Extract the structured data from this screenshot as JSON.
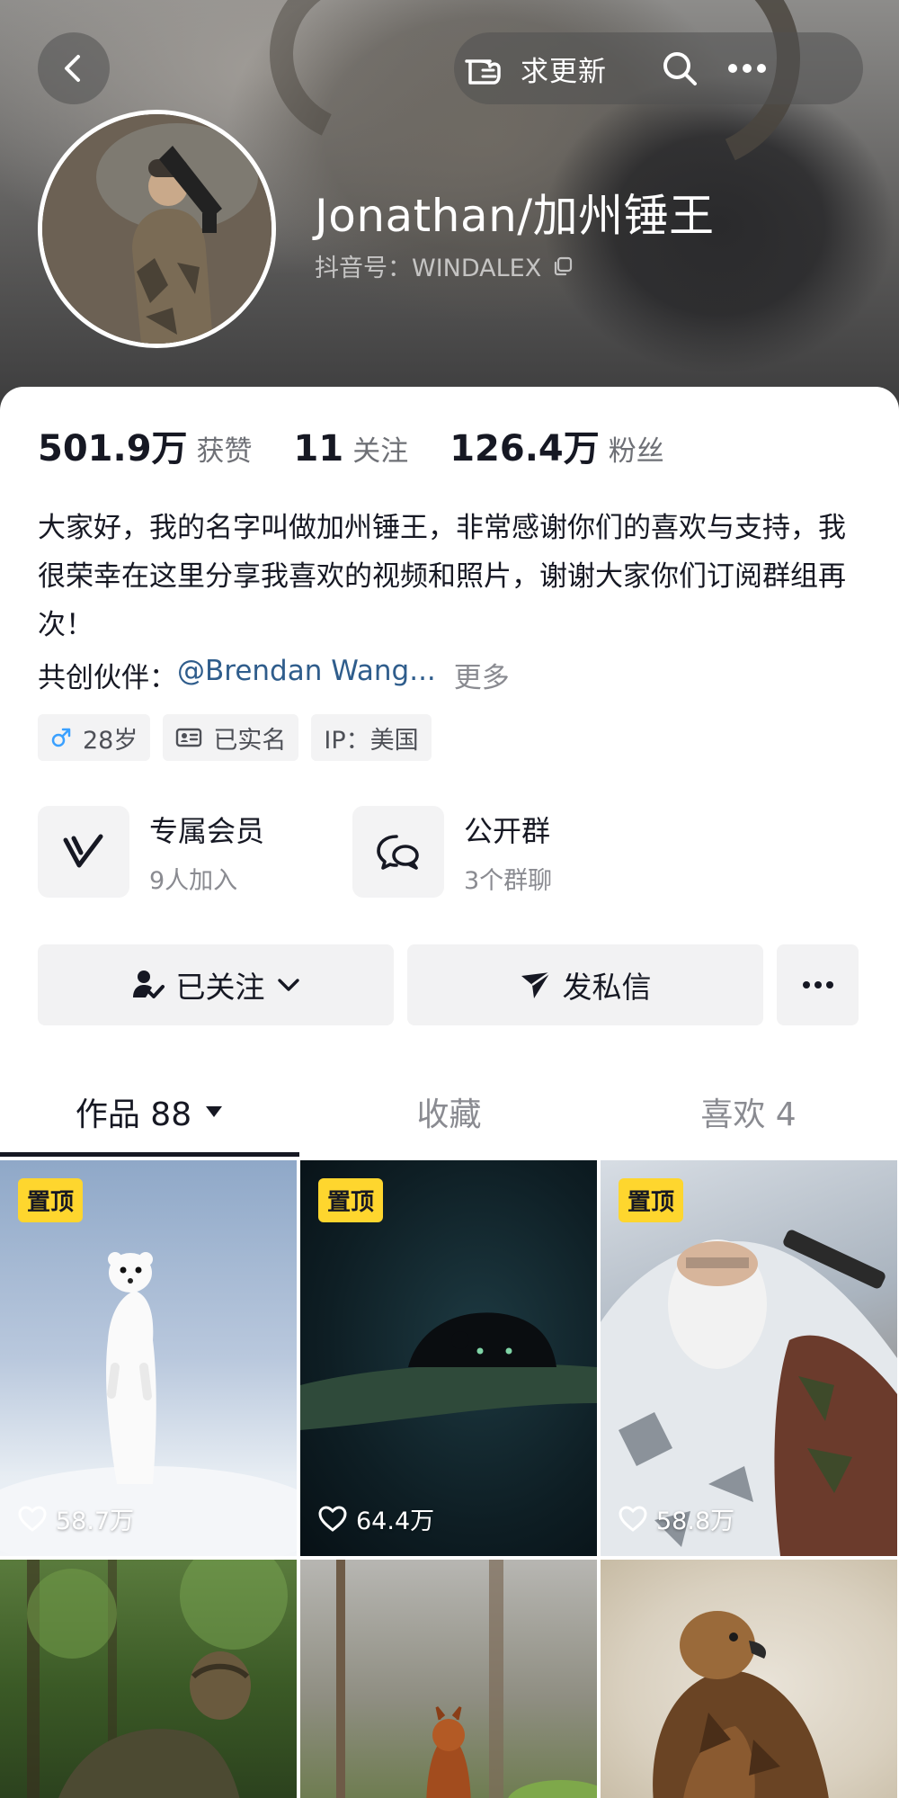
{
  "header": {
    "update_label": "求更新",
    "nickname": "Jonathan/加州锤王",
    "douyin_id": "抖音号：WINDALEX"
  },
  "stats": [
    {
      "value": "501.9万",
      "label": "获赞"
    },
    {
      "value": "11",
      "label": "关注"
    },
    {
      "value": "126.4万",
      "label": "粉丝"
    }
  ],
  "bio": "大家好，我的名字叫做加州锤王，非常感谢你们的喜欢与支持，我很荣幸在这里分享我喜欢的视频和照片，谢谢大家你们订阅群组再次！",
  "partner": {
    "label": "共创伙伴：",
    "link": "@Brendan Wang...",
    "more": "更多"
  },
  "tags": {
    "age": "28岁",
    "verified": "已实名",
    "ip": "IP：美国"
  },
  "features": {
    "membership": {
      "title": "专属会员",
      "sub": "9人加入"
    },
    "group": {
      "title": "公开群",
      "sub": "3个群聊"
    }
  },
  "actions": {
    "follow": "已关注",
    "message": "发私信"
  },
  "tabs": {
    "works": "作品 88",
    "favorites": "收藏",
    "likes": "喜欢 4"
  },
  "grid": {
    "pin_label": "置顶",
    "items": [
      {
        "likes": "58.7万"
      },
      {
        "likes": "64.4万"
      },
      {
        "likes": "58.8万"
      }
    ]
  },
  "colors": {
    "pin_badge": "#fed62e",
    "partner_link": "#2f5d8c",
    "male_icon": "#3aa0ff"
  }
}
